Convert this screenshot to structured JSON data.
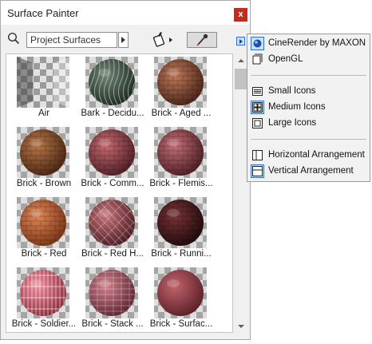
{
  "window": {
    "title": "Surface Painter",
    "close_label": "x"
  },
  "toolbar": {
    "search_value": "Project Surfaces"
  },
  "surfaces": [
    {
      "name": "Air",
      "icon": "air-surface-swatch"
    },
    {
      "name": "Bark - Decidu...",
      "icon": "bark-surface-swatch"
    },
    {
      "name": "Brick - Aged ...",
      "icon": "aged-brick-surface-swatch"
    },
    {
      "name": "Brick - Brown",
      "icon": "brown-brick-surface-swatch"
    },
    {
      "name": "Brick - Comm...",
      "icon": "common-brick-surface-swatch"
    },
    {
      "name": "Brick - Flemis...",
      "icon": "flemish-brick-surface-swatch"
    },
    {
      "name": "Brick - Red",
      "icon": "red-brick-surface-swatch"
    },
    {
      "name": "Brick - Red H...",
      "icon": "red-herringbone-brick-surface-swatch"
    },
    {
      "name": "Brick - Runni...",
      "icon": "running-brick-surface-swatch"
    },
    {
      "name": "Brick - Soldier...",
      "icon": "soldier-brick-surface-swatch"
    },
    {
      "name": "Brick - Stack ...",
      "icon": "stack-brick-surface-swatch"
    },
    {
      "name": "Brick - Surfac...",
      "icon": "brick-surface-swatch"
    }
  ],
  "menu": {
    "renderers": [
      {
        "label": "CineRender by MAXON",
        "icon": "cinerender-icon",
        "selected": true
      },
      {
        "label": "OpenGL",
        "icon": "opengl-icon",
        "selected": false
      }
    ],
    "icon_sizes": [
      {
        "label": "Small Icons",
        "icon": "small-icons-icon",
        "selected": false
      },
      {
        "label": "Medium Icons",
        "icon": "medium-icons-icon",
        "selected": true
      },
      {
        "label": "Large Icons",
        "icon": "large-icons-icon",
        "selected": false
      }
    ],
    "arrangements": [
      {
        "label": "Horizontal Arrangement",
        "icon": "horizontal-arrangement-icon",
        "selected": false
      },
      {
        "label": "Vertical Arrangement",
        "icon": "vertical-arrangement-icon",
        "selected": true
      }
    ]
  },
  "colors": {
    "accent": "#2e6fd6",
    "close": "#c42b1c"
  }
}
